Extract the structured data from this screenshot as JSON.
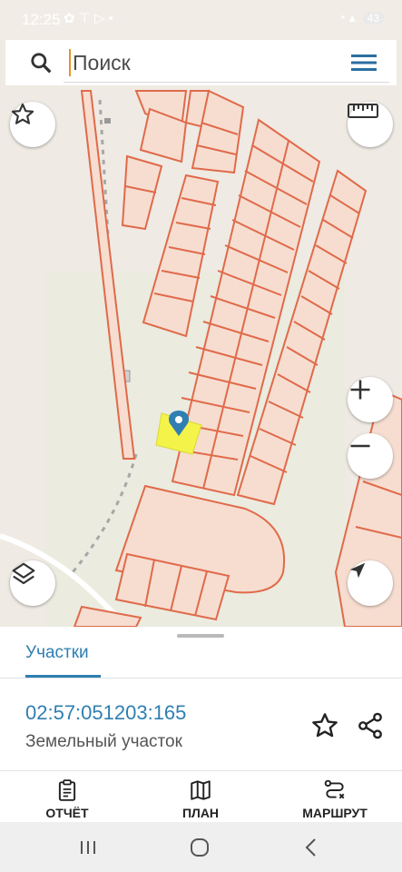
{
  "status_bar": {
    "time": "12:25",
    "battery": "43"
  },
  "search": {
    "placeholder": "Поиск",
    "value": ""
  },
  "map": {
    "marker_color": "#2f7fb2",
    "selected_parcel_color": "#f3f34a",
    "parcel_outline_color": "#e06a4a",
    "parcel_fill_color": "#f6ddd0"
  },
  "panel": {
    "tab_label": "Участки",
    "parcel_number": "02:57:051203:165",
    "parcel_type": "Земельный участок",
    "actions": [
      {
        "label": "ОТЧЁТ",
        "icon": "clipboard-icon"
      },
      {
        "label": "ПЛАН",
        "icon": "map-icon"
      },
      {
        "label": "МАРШРУТ",
        "icon": "route-icon"
      }
    ]
  },
  "colors": {
    "accent": "#2f7fb2",
    "menu": "#2c6ea0"
  }
}
